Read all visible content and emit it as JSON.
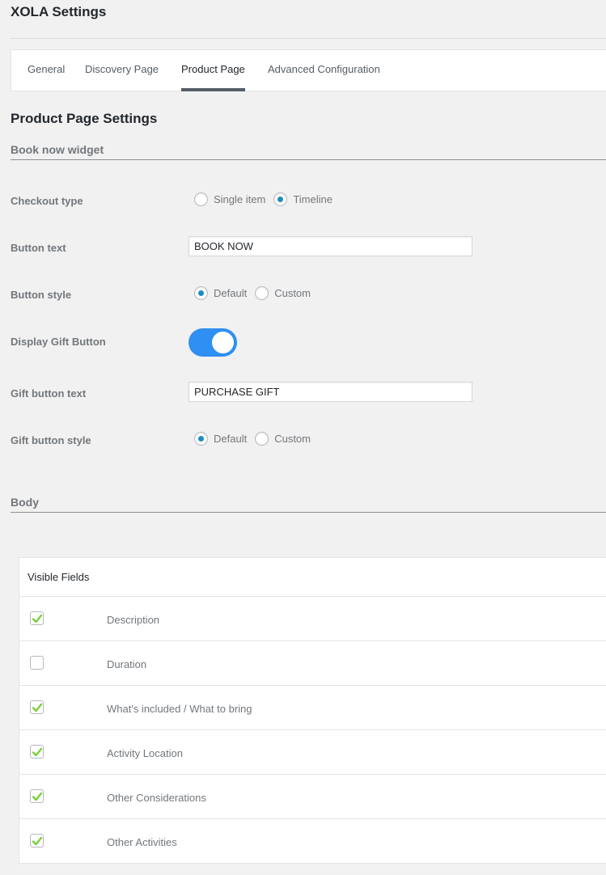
{
  "page": {
    "title": "XOLA Settings"
  },
  "tabs": [
    {
      "label": "General",
      "active": false
    },
    {
      "label": "Discovery Page",
      "active": false
    },
    {
      "label": "Product Page",
      "active": true
    },
    {
      "label": "Advanced Configuration",
      "active": false
    }
  ],
  "section_title": "Product Page Settings",
  "book_now_widget": {
    "heading": "Book now widget",
    "checkout_type": {
      "label": "Checkout type",
      "options": [
        "Single item",
        "Timeline"
      ],
      "selected": "Timeline"
    },
    "button_text": {
      "label": "Button text",
      "value": "BOOK NOW"
    },
    "button_style": {
      "label": "Button style",
      "options": [
        "Default",
        "Custom"
      ],
      "selected": "Default"
    },
    "display_gift_button": {
      "label": "Display Gift Button",
      "on": true
    },
    "gift_button_text": {
      "label": "Gift button text",
      "value": "PURCHASE GIFT"
    },
    "gift_button_style": {
      "label": "Gift button style",
      "options": [
        "Default",
        "Custom"
      ],
      "selected": "Default"
    }
  },
  "body": {
    "heading": "Body",
    "visible_fields": {
      "header": "Visible Fields",
      "rows": [
        {
          "label": "Description",
          "checked": true
        },
        {
          "label": "Duration",
          "checked": false
        },
        {
          "label": "What's included / What to bring",
          "checked": true
        },
        {
          "label": "Activity Location",
          "checked": true
        },
        {
          "label": "Other Considerations",
          "checked": true
        },
        {
          "label": "Other Activities",
          "checked": true
        }
      ]
    }
  },
  "colors": {
    "radio_selected": "#1e8cbe",
    "toggle_on": "#2f8ff2",
    "checkmark": "#7ad03a",
    "active_tab_underline": "#555d66"
  }
}
